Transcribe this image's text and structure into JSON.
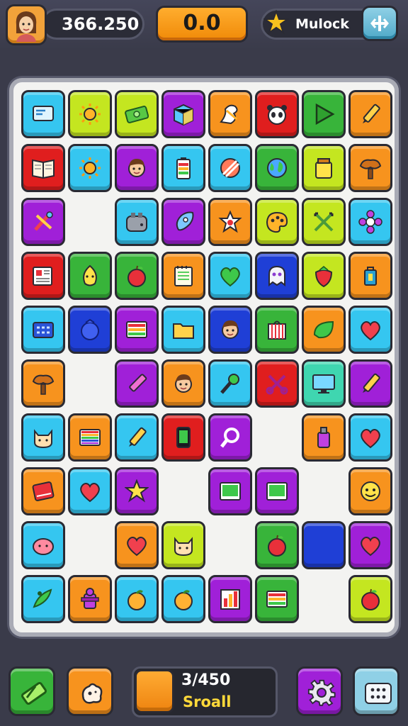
{
  "hud": {
    "score": "366.250",
    "timer": "0.0",
    "unlock_label": "Mulock"
  },
  "footer": {
    "progress_count": "3/450",
    "progress_label": "Sroall"
  },
  "colors": {
    "background": "#3a3b4a",
    "board": "#f3f3f1",
    "accent_orange": "#f7931e",
    "accent_blue": "#4fa9c8"
  },
  "board": {
    "rows": 10,
    "columns": 8,
    "tiles": [
      {
        "row": 0,
        "col": 0,
        "color": "#35c6f0",
        "icon": "card-icon"
      },
      {
        "row": 0,
        "col": 1,
        "color": "#c4e620",
        "icon": "sun-icon"
      },
      {
        "row": 0,
        "col": 2,
        "color": "#c4e620",
        "icon": "money-icon"
      },
      {
        "row": 0,
        "col": 3,
        "color": "#a020d8",
        "icon": "gift-box-icon"
      },
      {
        "row": 0,
        "col": 4,
        "color": "#f7931e",
        "icon": "dragon-icon"
      },
      {
        "row": 0,
        "col": 5,
        "color": "#e01e1e",
        "icon": "panda-icon"
      },
      {
        "row": 0,
        "col": 6,
        "color": "#38b43a",
        "icon": "play-icon"
      },
      {
        "row": 0,
        "col": 7,
        "color": "#f7931e",
        "icon": "pencil-icon"
      },
      {
        "row": 1,
        "col": 0,
        "color": "#e01e1e",
        "icon": "book-icon"
      },
      {
        "row": 1,
        "col": 1,
        "color": "#35c6f0",
        "icon": "sun-icon"
      },
      {
        "row": 1,
        "col": 2,
        "color": "#a020d8",
        "icon": "man-face-icon"
      },
      {
        "row": 1,
        "col": 3,
        "color": "#35c6f0",
        "icon": "battery-icon"
      },
      {
        "row": 1,
        "col": 4,
        "color": "#35c6f0",
        "icon": "striped-ball-icon"
      },
      {
        "row": 1,
        "col": 5,
        "color": "#38b43a",
        "icon": "globe-icon"
      },
      {
        "row": 1,
        "col": 6,
        "color": "#c4e620",
        "icon": "jar-icon"
      },
      {
        "row": 1,
        "col": 7,
        "color": "#f7931e",
        "icon": "tree-icon"
      },
      {
        "row": 2,
        "col": 0,
        "color": "#a020d8",
        "icon": "paint-tools-icon"
      },
      {
        "row": 2,
        "col": 2,
        "color": "#35c6f0",
        "icon": "toaster-icon"
      },
      {
        "row": 2,
        "col": 3,
        "color": "#a020d8",
        "icon": "rocket-icon"
      },
      {
        "row": 2,
        "col": 4,
        "color": "#f7931e",
        "icon": "star-badge-icon"
      },
      {
        "row": 2,
        "col": 5,
        "color": "#c4e620",
        "icon": "palette-icon"
      },
      {
        "row": 2,
        "col": 6,
        "color": "#c4e620",
        "icon": "crossed-swords-icon"
      },
      {
        "row": 2,
        "col": 7,
        "color": "#35c6f0",
        "icon": "flower-icon"
      },
      {
        "row": 3,
        "col": 0,
        "color": "#e01e1e",
        "icon": "newspaper-icon"
      },
      {
        "row": 3,
        "col": 1,
        "color": "#38b43a",
        "icon": "leaf-face-icon"
      },
      {
        "row": 3,
        "col": 2,
        "color": "#38b43a",
        "icon": "apple-icon"
      },
      {
        "row": 3,
        "col": 3,
        "color": "#f7931e",
        "icon": "notepad-icon"
      },
      {
        "row": 3,
        "col": 4,
        "color": "#35c6f0",
        "icon": "green-heart-icon"
      },
      {
        "row": 3,
        "col": 5,
        "color": "#1f3fd6",
        "icon": "ghost-icon"
      },
      {
        "row": 3,
        "col": 6,
        "color": "#c4e620",
        "icon": "strawberry-icon"
      },
      {
        "row": 3,
        "col": 7,
        "color": "#f7931e",
        "icon": "lantern-icon"
      },
      {
        "row": 4,
        "col": 0,
        "color": "#35c6f0",
        "icon": "calculator-icon"
      },
      {
        "row": 4,
        "col": 1,
        "color": "#1f3fd6",
        "icon": "round-creature-icon"
      },
      {
        "row": 4,
        "col": 2,
        "color": "#a020d8",
        "icon": "stripes-icon"
      },
      {
        "row": 4,
        "col": 3,
        "color": "#35c6f0",
        "icon": "folder-icon"
      },
      {
        "row": 4,
        "col": 4,
        "color": "#1f3fd6",
        "icon": "boy-face-icon"
      },
      {
        "row": 4,
        "col": 5,
        "color": "#38b43a",
        "icon": "cage-icon"
      },
      {
        "row": 4,
        "col": 6,
        "color": "#f7931e",
        "icon": "leaf-icon"
      },
      {
        "row": 4,
        "col": 7,
        "color": "#35c6f0",
        "icon": "heart-icon"
      },
      {
        "row": 5,
        "col": 0,
        "color": "#f7931e",
        "icon": "tree-icon"
      },
      {
        "row": 5,
        "col": 2,
        "color": "#a020d8",
        "icon": "crayon-icon"
      },
      {
        "row": 5,
        "col": 3,
        "color": "#f7931e",
        "icon": "boy-face-icon"
      },
      {
        "row": 5,
        "col": 4,
        "color": "#35c6f0",
        "icon": "microphone-icon"
      },
      {
        "row": 5,
        "col": 5,
        "color": "#e01e1e",
        "icon": "scissors-icon"
      },
      {
        "row": 5,
        "col": 6,
        "color": "#3fd6b0",
        "icon": "monitor-icon"
      },
      {
        "row": 5,
        "col": 7,
        "color": "#a020d8",
        "icon": "pencil-icon"
      },
      {
        "row": 6,
        "col": 0,
        "color": "#35c6f0",
        "icon": "cat-face-icon"
      },
      {
        "row": 6,
        "col": 1,
        "color": "#f7931e",
        "icon": "rainbow-stripes-icon"
      },
      {
        "row": 6,
        "col": 2,
        "color": "#35c6f0",
        "icon": "pencil-icon"
      },
      {
        "row": 6,
        "col": 3,
        "color": "#e01e1e",
        "icon": "phone-icon"
      },
      {
        "row": 6,
        "col": 4,
        "color": "#a020d8",
        "icon": "magnifier-icon"
      },
      {
        "row": 6,
        "col": 6,
        "color": "#f7931e",
        "icon": "potion-icon"
      },
      {
        "row": 6,
        "col": 7,
        "color": "#35c6f0",
        "icon": "heart-icon"
      },
      {
        "row": 7,
        "col": 0,
        "color": "#f7931e",
        "icon": "red-book-icon"
      },
      {
        "row": 7,
        "col": 1,
        "color": "#35c6f0",
        "icon": "heart-icon"
      },
      {
        "row": 7,
        "col": 2,
        "color": "#a020d8",
        "icon": "star-icon"
      },
      {
        "row": 7,
        "col": 4,
        "color": "#a020d8",
        "icon": "tablet-icon"
      },
      {
        "row": 7,
        "col": 5,
        "color": "#a020d8",
        "icon": "tablet-icon"
      },
      {
        "row": 7,
        "col": 7,
        "color": "#f7931e",
        "icon": "smiley-icon"
      },
      {
        "row": 8,
        "col": 0,
        "color": "#35c6f0",
        "icon": "blob-icon"
      },
      {
        "row": 8,
        "col": 2,
        "color": "#f7931e",
        "icon": "heart-icon"
      },
      {
        "row": 8,
        "col": 3,
        "color": "#c4e620",
        "icon": "cat-face-icon"
      },
      {
        "row": 8,
        "col": 5,
        "color": "#38b43a",
        "icon": "apple-icon"
      },
      {
        "row": 8,
        "col": 6,
        "color": "#1f3fd6",
        "icon": "blank-icon"
      },
      {
        "row": 8,
        "col": 7,
        "color": "#a020d8",
        "icon": "heart-icon"
      },
      {
        "row": 9,
        "col": 0,
        "color": "#35c6f0",
        "icon": "paw-leaf-icon"
      },
      {
        "row": 9,
        "col": 1,
        "color": "#f7931e",
        "icon": "fire-hydrant-icon"
      },
      {
        "row": 9,
        "col": 2,
        "color": "#35c6f0",
        "icon": "peach-icon"
      },
      {
        "row": 9,
        "col": 3,
        "color": "#35c6f0",
        "icon": "peach-icon"
      },
      {
        "row": 9,
        "col": 4,
        "color": "#a020d8",
        "icon": "bar-chart-icon"
      },
      {
        "row": 9,
        "col": 5,
        "color": "#38b43a",
        "icon": "stripes-icon"
      },
      {
        "row": 9,
        "col": 7,
        "color": "#c4e620",
        "icon": "apple-icon"
      }
    ]
  },
  "buttons": [
    {
      "name": "eraser-button",
      "icon": "eraser-icon",
      "color": "#38b43a"
    },
    {
      "name": "hint-button",
      "icon": "blob-hint-icon",
      "color": "#f7931e"
    },
    {
      "name": "settings-button",
      "icon": "gear-icon",
      "color": "#a020d8"
    },
    {
      "name": "menu-button",
      "icon": "grid-dots-icon",
      "color": "#8fd0e6"
    }
  ]
}
